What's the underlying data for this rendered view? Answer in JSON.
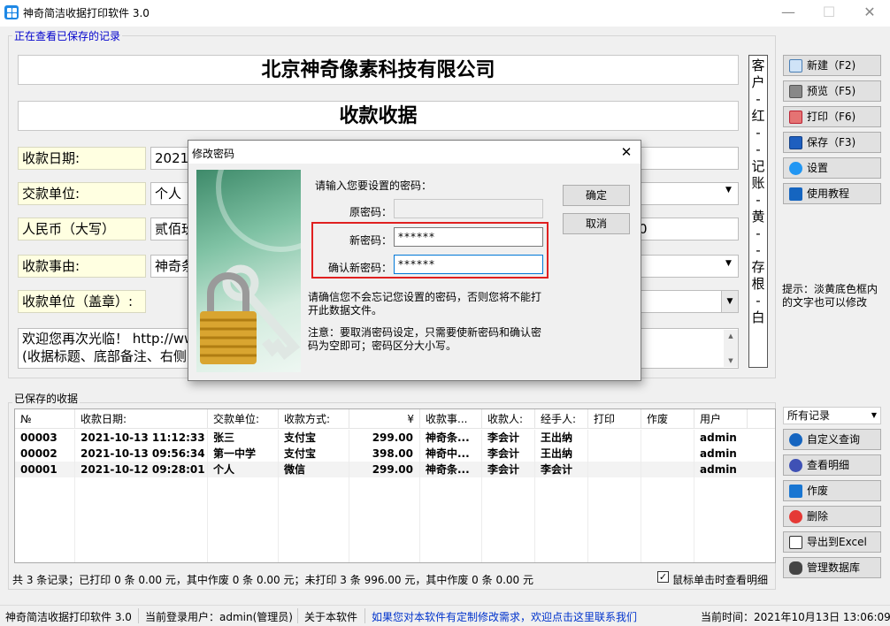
{
  "window": {
    "title": "神奇简洁收据打印软件 3.0",
    "minimize": "—",
    "maximize": "☐",
    "close": "✕"
  },
  "record_group": {
    "label": "正在查看已保存的记录",
    "company": "北京神奇像素科技有限公司",
    "doc_title": "收款收据",
    "fields": [
      {
        "label": "收款日期:",
        "value": "2021/"
      },
      {
        "label": "交款单位:",
        "value": "个人"
      },
      {
        "label": "人民币（大写）",
        "value": "贰佰玖"
      },
      {
        "label": "收款事由:",
        "value": "神奇条"
      },
      {
        "label": "收款单位（盖章）:",
        "value": ""
      }
    ],
    "note_lines": [
      "欢迎您再次光临！ http://ww",
      "(收据标题、底部备注、右侧"
    ],
    "right_number_fragment": "0",
    "stamp_fragment": "司",
    "side_vertical": [
      "客",
      "户",
      "-",
      "红",
      "-",
      "-",
      "记",
      "账",
      "-",
      "黄",
      "-",
      "-",
      "存",
      "根",
      "-",
      "白"
    ]
  },
  "toolbar": {
    "new": "新建（F2)",
    "preview": "预览（F5)",
    "print": "打印（F6)",
    "save": "保存（F3)",
    "settings": "设置",
    "tutorial": "使用教程",
    "tip": "提示：淡黄底色框内的文字也可以修改"
  },
  "saved_group": {
    "label": "已保存的收据",
    "filter_value": "所有记录",
    "columns": [
      "№",
      "收款日期:",
      "交款单位:",
      "收款方式:",
      "¥",
      "收款事...",
      "收款人:",
      "经手人:",
      "打印",
      "作废",
      "用户"
    ],
    "rows": [
      [
        "00003",
        "2021-10-13 11:12:33",
        "张三",
        "支付宝",
        "299.00",
        "神奇条...",
        "李会计",
        "王出纳",
        "",
        "",
        "admin"
      ],
      [
        "00002",
        "2021-10-13 09:56:34",
        "第一中学",
        "支付宝",
        "398.00",
        "神奇中...",
        "李会计",
        "王出纳",
        "",
        "",
        "admin"
      ],
      [
        "00001",
        "2021-10-12 09:28:01",
        "个人",
        "微信",
        "299.00",
        "神奇条...",
        "李会计",
        "李会计",
        "",
        "",
        "admin"
      ]
    ],
    "summary": "共 3 条记录；已打印 0 条 0.00 元，其中作废 0 条 0.00 元；未打印 3 条 996.00 元，其中作废 0 条 0.00 元",
    "click_detail_label": "鼠标单击时查看明细",
    "click_detail_checked": true
  },
  "side_actions": {
    "custom_query": "自定义查询",
    "view_detail": "查看明细",
    "void": "作废",
    "delete": "删除",
    "export_excel": "导出到Excel",
    "manage_db": "管理数据库"
  },
  "dialog": {
    "title": "修改密码",
    "prompt": "请输入您要设置的密码：",
    "old_label": "原密码：",
    "new_label": "新密码：",
    "confirm_label": "确认新密码：",
    "old_value": "",
    "new_value": "******",
    "confirm_value": "******",
    "ok": "确定",
    "cancel": "取消",
    "warning": "请确信您不会忘记您设置的密码，否则您将不能打开此数据文件。",
    "note": "注意：要取消密码设定，只需要使新密码和确认密码为空即可；密码区分大小写。",
    "highlight_color": "#e02020"
  },
  "status": {
    "app": "神奇简洁收据打印软件 3.0",
    "user": "当前登录用户：admin(管理员)",
    "about": "关于本软件",
    "contact": "如果您对本软件有定制修改需求，欢迎点击这里联系我们",
    "time": "当前时间：2021年10月13日 13:06:09",
    "contact_color": "#0033cc"
  }
}
